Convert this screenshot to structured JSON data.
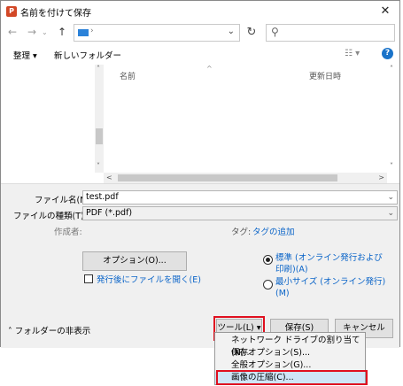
{
  "window": {
    "title": "名前を付けて保存",
    "app_icon": "P"
  },
  "nav": {
    "back_icon": "←",
    "forward_icon": "→",
    "up_icon": "↑",
    "address_sep": "›",
    "dropdown_icon": "⌄",
    "refresh_icon": "↻",
    "search_icon": "⚲"
  },
  "toolbar": {
    "organize": "整理 ▾",
    "new_folder": "新しいフォルダー",
    "view_icon": "☷ ▾",
    "help_icon": "?"
  },
  "file_list": {
    "col_name": "名前",
    "col_modified": "更新日時",
    "sort_caret": "^"
  },
  "form": {
    "filename_label": "ファイル名(N):",
    "filename_value": "test.pdf",
    "filetype_label": "ファイルの種類(T):",
    "filetype_value": "PDF (*.pdf)",
    "author_label": "作成者:",
    "tag_label": "タグ:",
    "tag_link": "タグの追加",
    "options_button": "オプション(O)...",
    "open_after_label": "発行後にファイルを開く(E)",
    "radio_standard": "標準 (オンライン発行および印刷)(A)",
    "radio_minimum": "最小サイズ (オンライン発行)(M)"
  },
  "footer": {
    "hide_folders": "フォルダーの非表示",
    "tools_button": "ツール(L)",
    "save_button": "保存(S)",
    "cancel_button": "キャンセル"
  },
  "tools_menu": [
    {
      "label": "ネットワーク ドライブの割り当て(N)..."
    },
    {
      "label": "保存オプション(S)..."
    },
    {
      "label": "全般オプション(G)..."
    },
    {
      "label": "画像の圧縮(C)..."
    }
  ],
  "colors": {
    "accent": "#0a64c8",
    "highlight_box": "#e01020",
    "folder": "#2b82d9"
  }
}
